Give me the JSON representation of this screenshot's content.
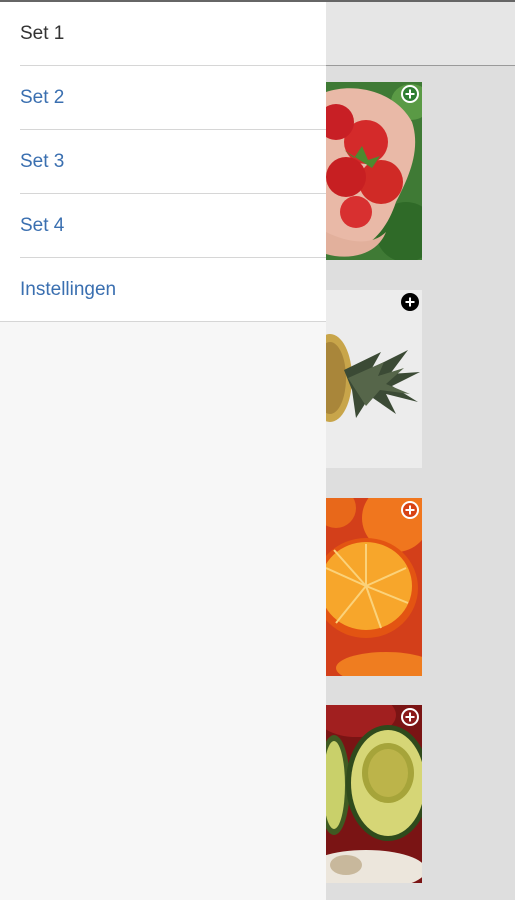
{
  "drawer": {
    "items": [
      {
        "label": "Set 1",
        "active": true
      },
      {
        "label": "Set 2",
        "active": false
      },
      {
        "label": "Set 3",
        "active": false
      },
      {
        "label": "Set 4",
        "active": false
      },
      {
        "label": "Instellingen",
        "active": false
      }
    ]
  },
  "tiles": [
    {
      "subject": "strawberries",
      "icon": "plus-circle-icon",
      "icon_color": "#2e7d32"
    },
    {
      "subject": "pineapple",
      "icon": "plus-circle-icon",
      "icon_color": "#000000"
    },
    {
      "subject": "oranges",
      "icon": "plus-circle-icon",
      "icon_color": "#d84315"
    },
    {
      "subject": "avocado",
      "icon": "plus-circle-icon",
      "icon_color": "#8b1a1a"
    }
  ],
  "colors": {
    "link": "#3a6fb0",
    "active_text": "#333333",
    "drawer_bg": "#f7f7f7",
    "scrim": "#dedede"
  }
}
